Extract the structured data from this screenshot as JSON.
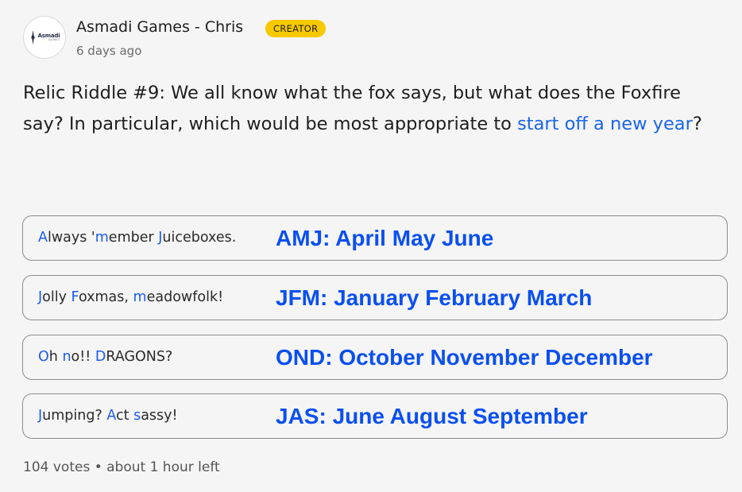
{
  "author": {
    "name": "Asmadi Games - Chris",
    "badge": "CREATOR",
    "timestamp": "6 days ago",
    "avatar": {
      "logo_word": "Asmadi",
      "logo_sub": "GAMES"
    }
  },
  "post": {
    "text_part1": "Relic Riddle #9: We all know what the fox says, but what does the Foxfire say? In particular, which would be most appropriate to ",
    "link_text": "start off a new year",
    "text_part2": "?"
  },
  "poll": {
    "options": [
      {
        "segments": [
          {
            "t": "A",
            "hl": true
          },
          {
            "t": "lways '",
            "hl": false
          },
          {
            "t": "m",
            "hl": true
          },
          {
            "t": "ember ",
            "hl": false
          },
          {
            "t": "J",
            "hl": true
          },
          {
            "t": "uiceboxes.",
            "hl": false
          }
        ],
        "annotation": "AMJ: April May June"
      },
      {
        "segments": [
          {
            "t": "J",
            "hl": true
          },
          {
            "t": "olly ",
            "hl": false
          },
          {
            "t": "F",
            "hl": true
          },
          {
            "t": "oxmas, ",
            "hl": false
          },
          {
            "t": "m",
            "hl": true
          },
          {
            "t": "eadowfolk!",
            "hl": false
          }
        ],
        "annotation": "JFM: January February March"
      },
      {
        "segments": [
          {
            "t": "O",
            "hl": true
          },
          {
            "t": "h ",
            "hl": false
          },
          {
            "t": "n",
            "hl": true
          },
          {
            "t": "o!! ",
            "hl": false
          },
          {
            "t": "D",
            "hl": true
          },
          {
            "t": "RAGONS?",
            "hl": false
          }
        ],
        "annotation": "OND: October November December"
      },
      {
        "segments": [
          {
            "t": "J",
            "hl": true
          },
          {
            "t": "umping? ",
            "hl": false
          },
          {
            "t": "A",
            "hl": true
          },
          {
            "t": "ct ",
            "hl": false
          },
          {
            "t": "s",
            "hl": true
          },
          {
            "t": "assy!",
            "hl": false
          }
        ],
        "annotation": "JAS: June August September"
      }
    ],
    "footer": "104 votes • about 1 hour left"
  },
  "colors": {
    "badge": "#f7c900",
    "link": "#1a66e8",
    "annotation": "#0a4ff0",
    "highlight_letter": "#1a5bf0"
  },
  "icons": {
    "avatar": "asmadi-games-logo"
  }
}
